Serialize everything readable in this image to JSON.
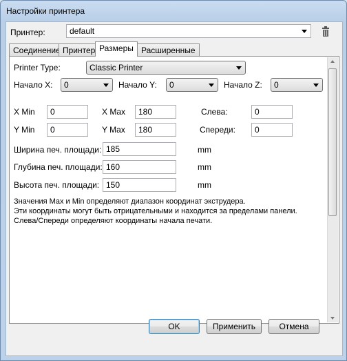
{
  "window": {
    "title": "Настройки принтера"
  },
  "printer": {
    "label": "Принтер:",
    "value": "default"
  },
  "tabs": [
    {
      "label": "Соединение"
    },
    {
      "label": "Принтер"
    },
    {
      "label": "Размеры"
    },
    {
      "label": "Расширенные"
    }
  ],
  "dimensions": {
    "printer_type": {
      "label": "Printer Type:",
      "value": "Classic Printer"
    },
    "start_x": {
      "label": "Начало X:",
      "value": "0"
    },
    "start_y": {
      "label": "Начало Y:",
      "value": "0"
    },
    "start_z": {
      "label": "Начало Z:",
      "value": "0"
    },
    "x_min": {
      "label": "X Min",
      "value": "0"
    },
    "x_max": {
      "label": "X Max",
      "value": "180"
    },
    "left": {
      "label": "Слева:",
      "value": "0"
    },
    "y_min": {
      "label": "Y Min",
      "value": "0"
    },
    "y_max": {
      "label": "Y Max",
      "value": "180"
    },
    "front": {
      "label": "Спереди:",
      "value": "0"
    },
    "bed_width": {
      "label": "Ширина печ. площади:",
      "value": "185",
      "unit": "mm"
    },
    "bed_depth": {
      "label": "Глубина печ. площади:",
      "value": "160",
      "unit": "mm"
    },
    "bed_height": {
      "label": "Высота печ. площади:",
      "value": "150",
      "unit": "mm"
    },
    "info": [
      "Значения Max и Min определяют диапазон координат экструдера.",
      "Эти координаты могут быть отрицательными и находится за пределами панели.",
      "Слева/Спереди определяют координаты начала печати."
    ]
  },
  "buttons": {
    "ok": "OK",
    "apply": "Применить",
    "cancel": "Отмена"
  }
}
